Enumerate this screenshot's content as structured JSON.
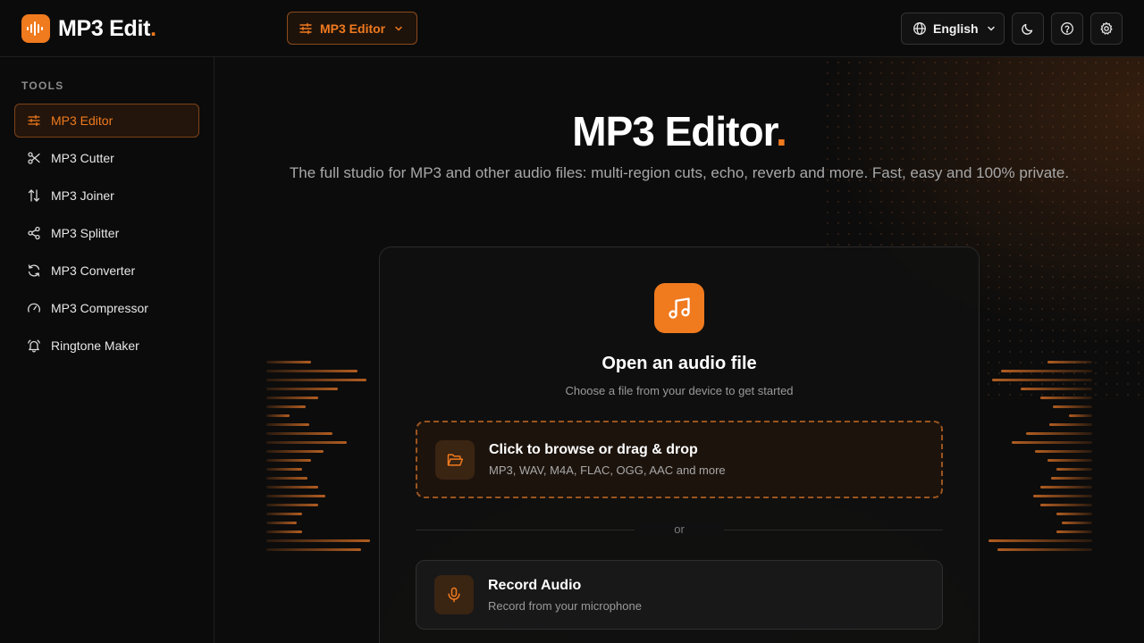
{
  "header": {
    "logo_text": "MP3 Edit",
    "logo_dot": ".",
    "tool_select_label": "MP3 Editor",
    "language_label": "English"
  },
  "sidebar": {
    "section_title": "TOOLS",
    "items": [
      {
        "label": "MP3 Editor",
        "icon": "sliders-icon",
        "active": true
      },
      {
        "label": "MP3 Cutter",
        "icon": "scissors-icon"
      },
      {
        "label": "MP3 Joiner",
        "icon": "arrows-up-down-icon"
      },
      {
        "label": "MP3 Splitter",
        "icon": "share-nodes-icon"
      },
      {
        "label": "MP3 Converter",
        "icon": "refresh-icon"
      },
      {
        "label": "MP3 Compressor",
        "icon": "gauge-icon"
      },
      {
        "label": "Ringtone Maker",
        "icon": "alarm-bell-icon"
      }
    ]
  },
  "hero": {
    "title": "MP3 Editor",
    "title_dot": ".",
    "subtitle": "The full studio for MP3 and other audio files: multi-region cuts, echo, reverb and more. Fast, easy and 100% private."
  },
  "upload_card": {
    "title": "Open an audio file",
    "subtitle": "Choose a file from your device to get started",
    "dropzone_title": "Click to browse or drag & drop",
    "dropzone_formats": "MP3, WAV, M4A, FLAC, OGG, AAC and more",
    "divider_text": "or",
    "record_title": "Record Audio",
    "record_subtitle": "Record from your microphone"
  },
  "colors": {
    "accent": "#f07a1e",
    "background": "#0c0c0c"
  }
}
